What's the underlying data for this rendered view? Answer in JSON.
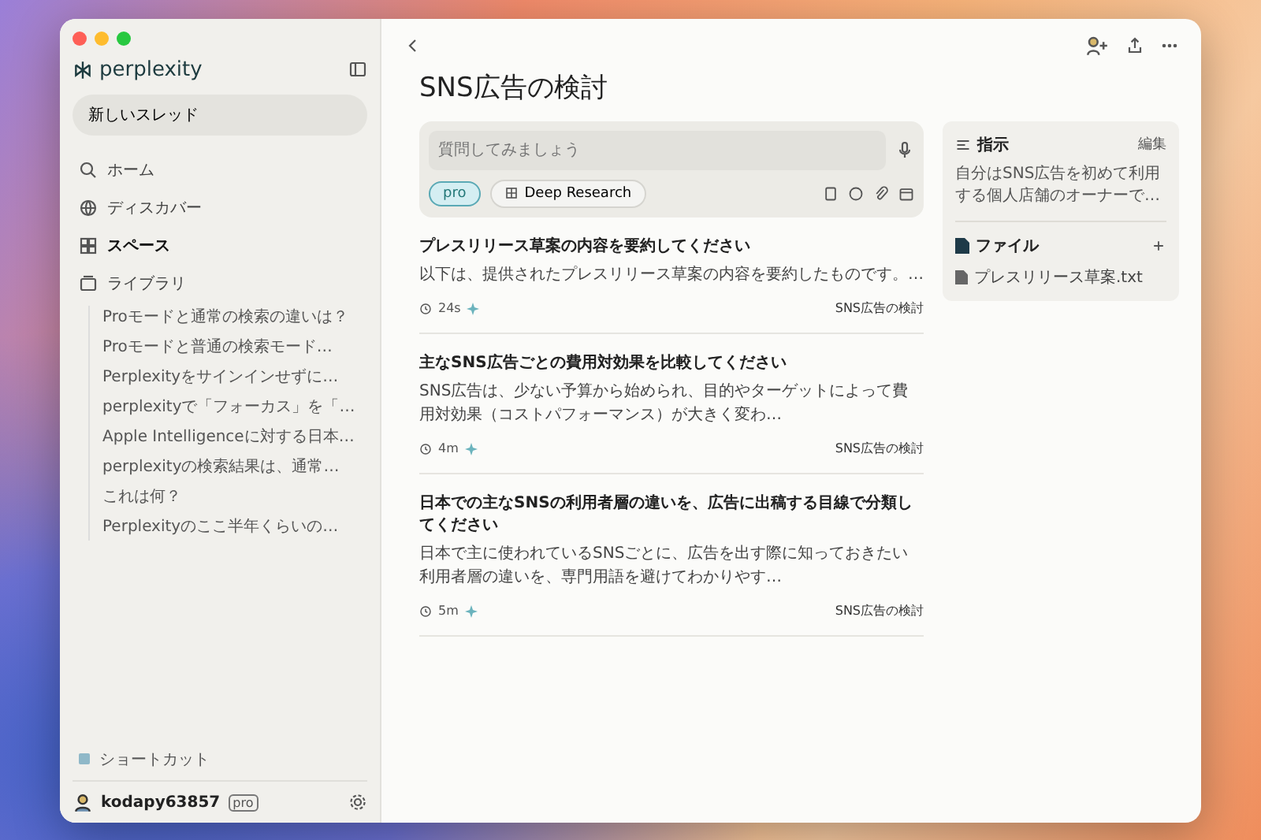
{
  "sidebar": {
    "brand": "perplexity",
    "new_thread": "新しいスレッド",
    "nav": [
      {
        "label": "ホーム",
        "selected": false,
        "kind": "home"
      },
      {
        "label": "ディスカバー",
        "selected": false,
        "kind": "discover"
      },
      {
        "label": "スペース",
        "selected": true,
        "kind": "spaces"
      },
      {
        "label": "ライブラリ",
        "selected": false,
        "kind": "library"
      }
    ],
    "recent": [
      "Proモードと通常の検索の違いは？",
      "Proモードと普通の検索モード…",
      "Perplexityをサインインせずに…",
      "perplexityで「フォーカス」を「…",
      "Apple Intelligenceに対する日本…",
      "perplexityの検索結果は、通常…",
      "これは何？",
      "Perplexityのここ半年くらいの…"
    ],
    "shortcut": "ショートカット",
    "user": {
      "name": "kodapy63857",
      "badge": "pro"
    }
  },
  "main": {
    "title": "SNS広告の検討",
    "input": {
      "placeholder": "質問してみましょう",
      "pro": {
        "label": "pro",
        "on": true
      },
      "deep_research": "Deep Research"
    },
    "threads": [
      {
        "title": "プレスリリース草案の内容を要約してください",
        "snippet": "以下は、提供されたプレスリリース草案の内容を要約したものです。…",
        "time": "24s",
        "space": "SNS広告の検討"
      },
      {
        "title": "主なSNS広告ごとの費用対効果を比較してください",
        "snippet": "SNS広告は、少ない予算から始められ、目的やターゲットによって費用対効果（コストパフォーマンス）が大きく変わ…",
        "time": "4m",
        "space": "SNS広告の検討"
      },
      {
        "title": "日本での主なSNSの利用者層の違いを、広告に出稿する目線で分類してください",
        "snippet": "日本で主に使われているSNSごとに、広告を出す際に知っておきたい利用者層の違いを、専門用語を避けてわかりやす…",
        "time": "5m",
        "space": "SNS広告の検討"
      }
    ]
  },
  "panel": {
    "instructions": {
      "title": "指示",
      "action": "編集",
      "text": "自分はSNS広告を初めて利用する個人店舗のオーナーで…"
    },
    "files": {
      "title": "ファイル",
      "items": [
        "プレスリリース草案.txt"
      ]
    }
  }
}
